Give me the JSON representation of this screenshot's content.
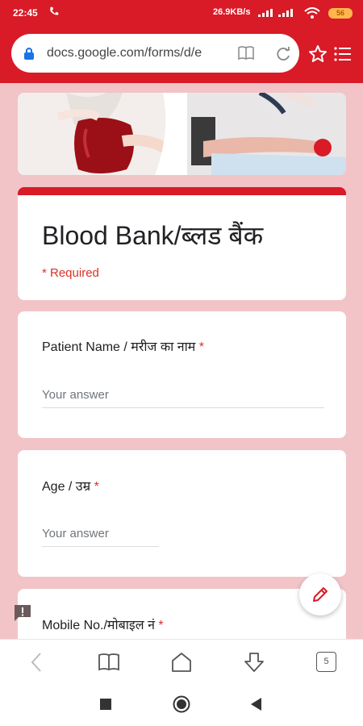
{
  "status_bar": {
    "time": "22:45",
    "net_speed": "26.9KB/s",
    "battery": "56"
  },
  "browser": {
    "url": "docs.google.com/forms/d/e",
    "tab_count": "5"
  },
  "form": {
    "title": "Blood Bank/ब्लड बैंक",
    "required_note": "* Required",
    "questions": [
      {
        "label": "Patient Name / मरीज का नाम",
        "required_mark": "*",
        "placeholder": "Your answer"
      },
      {
        "label": "Age / उम्र",
        "required_mark": "*",
        "placeholder": "Your answer"
      },
      {
        "label": "Mobile No./मोबाइल नं",
        "required_mark": "*"
      }
    ]
  },
  "colors": {
    "brand_red": "#d81b27",
    "page_background": "#f2c4c7",
    "required_red": "#d93025"
  },
  "icons": [
    "lock-icon",
    "reader-mode-icon",
    "reload-icon",
    "star-icon",
    "menu-icon",
    "edit-pencil-icon",
    "feedback-icon",
    "back-icon",
    "bookmarks-icon",
    "home-icon",
    "download-icon",
    "tabs-icon",
    "recents-icon",
    "home-circle-icon",
    "nav-back-icon"
  ]
}
